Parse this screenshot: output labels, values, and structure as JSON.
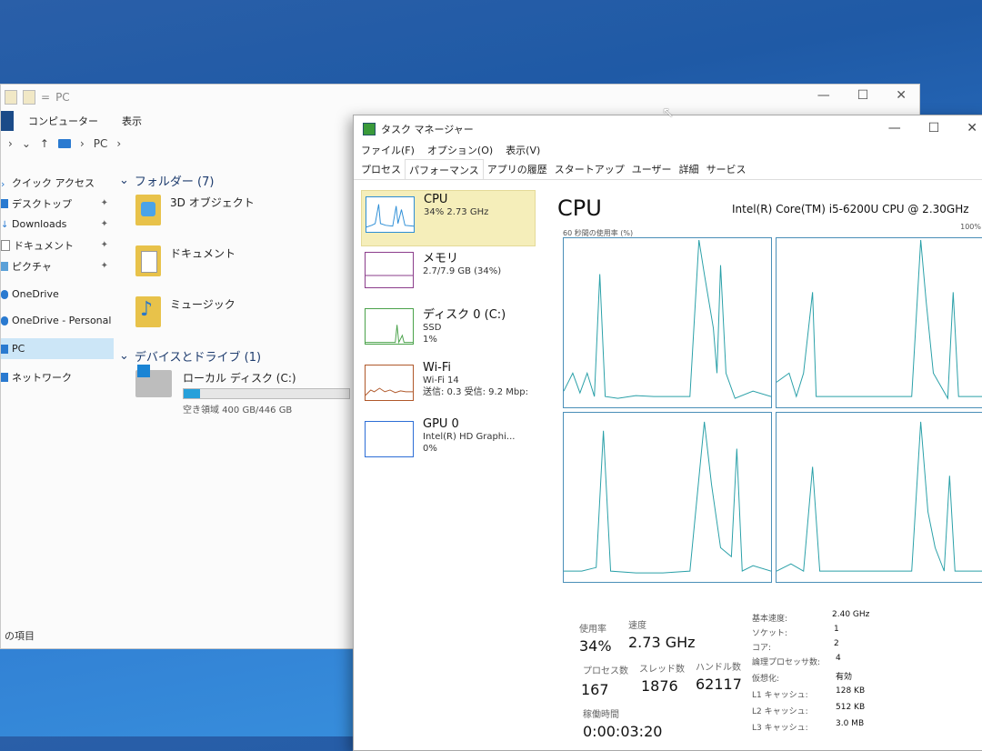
{
  "explorer": {
    "title": "PC",
    "ribbon_tabs": [
      "コンピューター",
      "表示"
    ],
    "address": "PC",
    "nav": [
      {
        "label": "クイック アクセス",
        "pinned": false,
        "selected": false
      },
      {
        "label": "デスクトップ",
        "pinned": true,
        "selected": false
      },
      {
        "label": "Downloads",
        "pinned": true,
        "selected": false
      },
      {
        "label": "ドキュメント",
        "pinned": true,
        "selected": false
      },
      {
        "label": "ピクチャ",
        "pinned": true,
        "selected": false
      },
      {
        "label": "OneDrive",
        "pinned": false,
        "selected": false
      },
      {
        "label": "OneDrive - Personal",
        "pinned": false,
        "selected": false
      },
      {
        "label": "PC",
        "pinned": false,
        "selected": true
      },
      {
        "label": "ネットワーク",
        "pinned": false,
        "selected": false
      }
    ],
    "folders_header": "フォルダー (7)",
    "folders": [
      "3D オブジェクト",
      "ドキュメント",
      "ミュージック"
    ],
    "devices_header": "デバイスとドライブ (1)",
    "drive": {
      "name": "ローカル ディスク (C:)",
      "space": "空き領域 400 GB/446 GB",
      "used_fraction": 0.1
    },
    "status": "の項目"
  },
  "taskmgr": {
    "title": "タスク マネージャー",
    "menu": [
      "ファイル(F)",
      "オプション(O)",
      "表示(V)"
    ],
    "tabs": [
      "プロセス",
      "パフォーマンス",
      "アプリの履歴",
      "スタートアップ",
      "ユーザー",
      "詳細",
      "サービス"
    ],
    "active_tab": "パフォーマンス",
    "resources": [
      {
        "name": "CPU",
        "lines": [
          "34% 2.73 GHz"
        ],
        "icon": "cpu-graph-icon"
      },
      {
        "name": "メモリ",
        "lines": [
          "2.7/7.9 GB (34%)"
        ],
        "icon": "memory-graph-icon"
      },
      {
        "name": "ディスク 0 (C:)",
        "lines": [
          "SSD",
          "1%"
        ],
        "icon": "disk-graph-icon"
      },
      {
        "name": "Wi-Fi",
        "lines": [
          "Wi-Fi 14",
          "送信: 0.3  受信: 9.2 Mbp:"
        ],
        "icon": "wifi-graph-icon"
      },
      {
        "name": "GPU 0",
        "lines": [
          "Intel(R) HD Graphi...",
          "0%"
        ],
        "icon": "gpu-graph-icon"
      }
    ],
    "cpu": {
      "heading": "CPU",
      "model": "Intel(R) Core(TM) i5-6200U CPU @ 2.30GHz",
      "graph_label": "60 秒間の使用率 (%)",
      "graph_max": "100%",
      "usage_label": "使用率",
      "usage": "34%",
      "speed_label": "速度",
      "speed": "2.73 GHz",
      "processes_label": "プロセス数",
      "processes": "167",
      "threads_label": "スレッド数",
      "threads": "1876",
      "handles_label": "ハンドル数",
      "handles": "62117",
      "uptime_label": "稼働時間",
      "uptime": "0:00:03:20",
      "specs": [
        {
          "k": "基本速度:",
          "v": "2.40 GHz"
        },
        {
          "k": "ソケット:",
          "v": "1"
        },
        {
          "k": "コア:",
          "v": "2"
        },
        {
          "k": "論理プロセッサ数:",
          "v": "4"
        },
        {
          "k": "仮想化:",
          "v": "有効"
        },
        {
          "k": "L1 キャッシュ:",
          "v": "128 KB"
        },
        {
          "k": "L2 キャッシュ:",
          "v": "512 KB"
        },
        {
          "k": "L3 キャッシュ:",
          "v": "3.0 MB"
        }
      ]
    }
  },
  "colors": {
    "cpu_line": "#2d8ed6",
    "selection": "#f5eeba",
    "nav_selected": "#cce6f7"
  }
}
